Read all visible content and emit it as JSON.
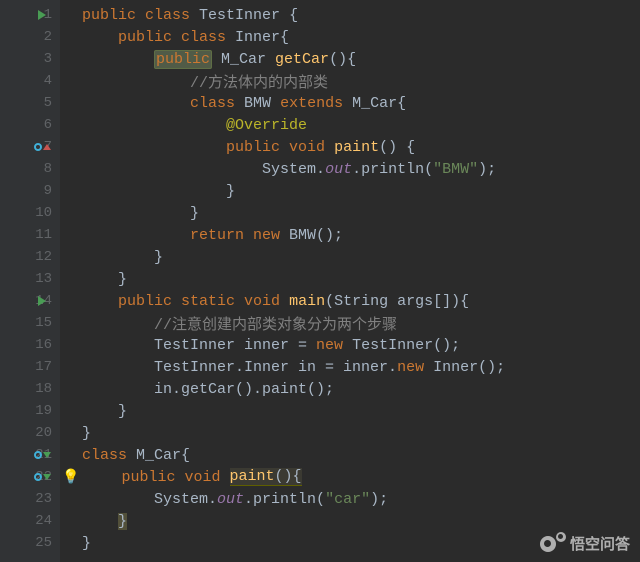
{
  "gutter": {
    "lines": [
      "1",
      "2",
      "3",
      "4",
      "5",
      "6",
      "7",
      "8",
      "9",
      "10",
      "11",
      "12",
      "13",
      "14",
      "15",
      "16",
      "17",
      "18",
      "19",
      "20",
      "21",
      "22",
      "23",
      "24",
      "25"
    ],
    "icons": {
      "1": "run",
      "7": "override-up",
      "14": "run",
      "21": "override-down",
      "22": "override-down-bulb"
    }
  },
  "code": {
    "l1": {
      "i": "  ",
      "t": [
        [
          "kw",
          "public class"
        ],
        [
          "op",
          " TestInner {"
        ]
      ]
    },
    "l2": {
      "i": "      ",
      "t": [
        [
          "kw",
          "public class"
        ],
        [
          "op",
          " Inner{"
        ]
      ]
    },
    "l3": {
      "i": "          ",
      "t": [
        [
          "kw-hl",
          "public"
        ],
        [
          "op",
          " M_Car "
        ],
        [
          "mth",
          "getCar"
        ],
        [
          "op",
          "(){"
        ]
      ]
    },
    "l4": {
      "i": "              ",
      "t": [
        [
          "cm",
          "//方法体内的内部类"
        ]
      ]
    },
    "l5": {
      "i": "              ",
      "t": [
        [
          "kw",
          "class"
        ],
        [
          "op",
          " BMW "
        ],
        [
          "kw",
          "extends"
        ],
        [
          "op",
          " M_Car{"
        ]
      ]
    },
    "l6": {
      "i": "                  ",
      "t": [
        [
          "ann",
          "@Override"
        ]
      ]
    },
    "l7": {
      "i": "                  ",
      "t": [
        [
          "kw",
          "public void"
        ],
        [
          "op",
          " "
        ],
        [
          "mth",
          "paint"
        ],
        [
          "op",
          "() {"
        ]
      ]
    },
    "l8": {
      "i": "                      ",
      "t": [
        [
          "op",
          "System."
        ],
        [
          "fld",
          "out"
        ],
        [
          "op",
          ".println("
        ],
        [
          "str",
          "\"BMW\""
        ],
        [
          "op",
          ");"
        ]
      ]
    },
    "l9": {
      "i": "                  ",
      "t": [
        [
          "op",
          "}"
        ]
      ]
    },
    "l10": {
      "i": "              ",
      "t": [
        [
          "op",
          "}"
        ]
      ]
    },
    "l11": {
      "i": "              ",
      "t": [
        [
          "kw",
          "return new"
        ],
        [
          "op",
          " BMW();"
        ]
      ]
    },
    "l12": {
      "i": "          ",
      "t": [
        [
          "op",
          "}"
        ]
      ]
    },
    "l13": {
      "i": "      ",
      "t": [
        [
          "op",
          "}"
        ]
      ]
    },
    "l14": {
      "i": "      ",
      "t": [
        [
          "kw",
          "public static void"
        ],
        [
          "op",
          " "
        ],
        [
          "mth",
          "main"
        ],
        [
          "op",
          "(String args[]){"
        ]
      ]
    },
    "l15": {
      "i": "          ",
      "t": [
        [
          "cm",
          "//注意创建内部类对象分为两个步骤"
        ]
      ]
    },
    "l16": {
      "i": "          ",
      "t": [
        [
          "op",
          "TestInner inner = "
        ],
        [
          "kw",
          "new"
        ],
        [
          "op",
          " TestInner();"
        ]
      ]
    },
    "l17": {
      "i": "          ",
      "t": [
        [
          "op",
          "TestInner.Inner in = inner."
        ],
        [
          "kw",
          "new"
        ],
        [
          "op",
          " Inner();"
        ]
      ]
    },
    "l18": {
      "i": "          ",
      "t": [
        [
          "op",
          "in.getCar().paint();"
        ]
      ]
    },
    "l19": {
      "i": "      ",
      "t": [
        [
          "op",
          "}"
        ]
      ]
    },
    "l20": {
      "i": "  ",
      "t": [
        [
          "op",
          "}"
        ]
      ]
    },
    "l21": {
      "i": "  ",
      "t": [
        [
          "kw",
          "class"
        ],
        [
          "op",
          " M_Car{"
        ]
      ]
    },
    "l22": {
      "i": "      ",
      "t": [
        [
          "kw",
          "public void"
        ],
        [
          "op",
          " "
        ],
        [
          "mth-hl",
          "paint"
        ],
        [
          "op-hl",
          "(){"
        ]
      ]
    },
    "l23": {
      "i": "          ",
      "t": [
        [
          "op",
          "System."
        ],
        [
          "fld",
          "out"
        ],
        [
          "op",
          ".println("
        ],
        [
          "str",
          "\"car\""
        ],
        [
          "op",
          ");"
        ]
      ]
    },
    "l24": {
      "i": "      ",
      "t": [
        [
          "op-err",
          "}"
        ]
      ]
    },
    "l25": {
      "i": "  ",
      "t": [
        [
          "op",
          "}"
        ]
      ]
    }
  },
  "watermark": "悟空问答"
}
